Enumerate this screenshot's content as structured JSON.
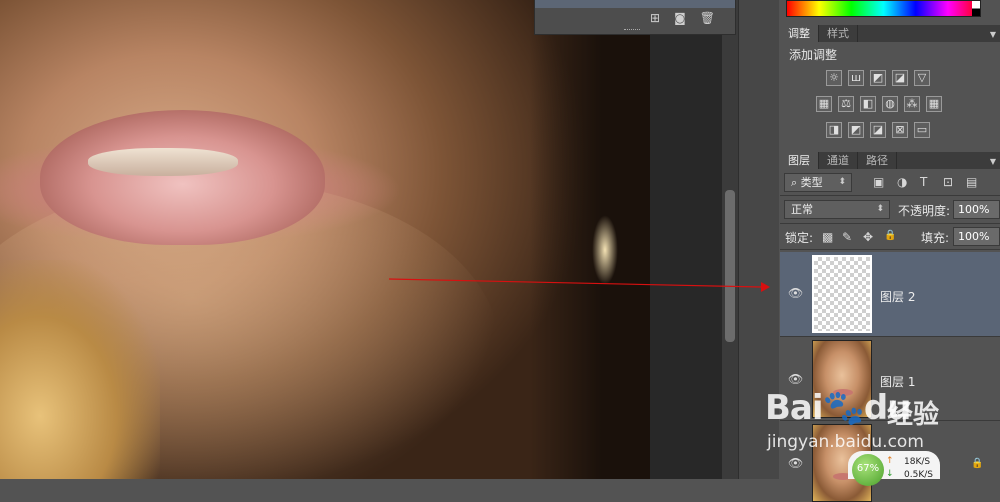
{
  "floating_panel": {
    "icons": [
      "new-layer-icon",
      "camera-icon",
      "trash-icon"
    ],
    "icon_glyphs": [
      "⊞",
      "◙",
      "🗑"
    ]
  },
  "right_panel": {
    "tabs_top": [
      {
        "label": "调整",
        "active": true
      },
      {
        "label": "样式",
        "active": false
      }
    ],
    "adjustments": {
      "title": "添加调整",
      "row1": [
        "☼",
        "ш",
        "◩",
        "◪",
        "▽"
      ],
      "row2": [
        "▦",
        "⚖",
        "◧",
        "◍",
        "⁂",
        "▦"
      ],
      "row3": [
        "◨",
        "◩",
        "◪",
        "⊠",
        "▭"
      ]
    },
    "tabs_layers": [
      {
        "label": "图层",
        "active": true
      },
      {
        "label": "通道",
        "active": false
      },
      {
        "label": "路径",
        "active": false
      }
    ],
    "filter": {
      "search_glyph": "⌕",
      "label": "类型",
      "tools": [
        "▣",
        "◑",
        "T",
        "⊡",
        "▤"
      ]
    },
    "blend": {
      "mode": "正常",
      "opacity_label": "不透明度:",
      "opacity_value": "100%"
    },
    "lock": {
      "label": "锁定:",
      "glyphs": [
        "▩",
        "✎",
        "✥",
        "🔒"
      ],
      "fill_label": "填充:",
      "fill_value": "100%"
    },
    "layers": [
      {
        "name": "图层 2",
        "selected": true,
        "type": "transparent"
      },
      {
        "name": "图层 1",
        "selected": false,
        "type": "photo"
      },
      {
        "name": "",
        "selected": false,
        "type": "photo"
      }
    ],
    "eye_glyph": "👁"
  },
  "watermark": {
    "logo": "Bai",
    "logo2": "du",
    "cn": "经验",
    "url": "jingyan.baidu.com"
  },
  "net_widget": {
    "percent": "67%",
    "up": "18K/S",
    "down": "0.5K/S",
    "up_arrow": "↑",
    "down_arrow": "↓"
  }
}
